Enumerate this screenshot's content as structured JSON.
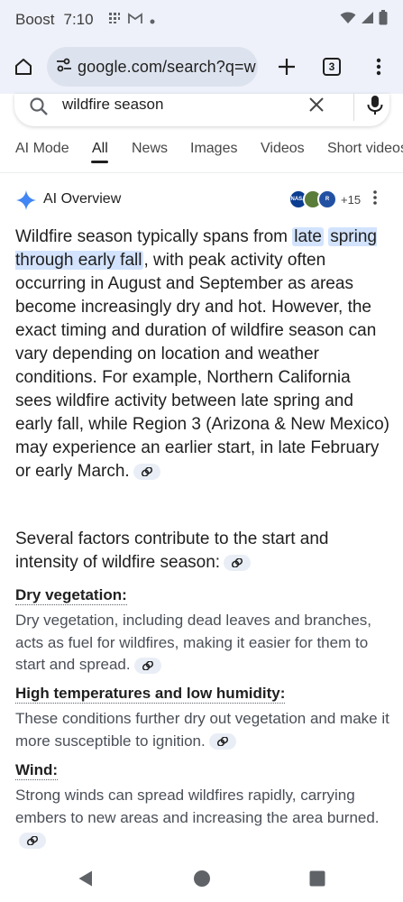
{
  "status": {
    "carrier": "Boost",
    "time": "7:10"
  },
  "browser": {
    "url": "google.com/search?q=w",
    "tab_count": "3"
  },
  "search": {
    "query": "wildfire season"
  },
  "tabs": [
    "AI Mode",
    "All",
    "News",
    "Images",
    "Videos",
    "Short videos"
  ],
  "ai": {
    "title": "AI Overview",
    "source_count": "+15",
    "p1_before": "Wildfire season typically spans from ",
    "p1_hl1": "late",
    "p1_hl2": "spring through early fall",
    "p1_after": ", with peak activity often occurring in August and September as areas become increasingly dry and hot. However, the exact timing and duration of wildfire season can vary depending on location and weather conditions. For example, Northern California sees wildfire activity between late spring and early fall, while Region 3 (Arizona & New Mexico) may experience an earlier start, in late February or early March.",
    "p2": "Several factors contribute to the start and intensity of wildfire season:",
    "factors": [
      {
        "heading": "Dry vegetation:",
        "text": "Dry vegetation, including dead leaves and branches, acts as fuel for wildfires, making it easier for them to start and spread."
      },
      {
        "heading": "High temperatures and low humidity:",
        "text": "These conditions further dry out vegetation and make it more susceptible to ignition."
      },
      {
        "heading": "Wind:",
        "text": "Strong winds can spread wildfires rapidly, carrying embers to new areas and increasing the area burned."
      }
    ]
  },
  "colors": {
    "highlight": "#d3e3fd",
    "chrome": "#eef1f9",
    "gemini_blue": "#4285f4"
  }
}
